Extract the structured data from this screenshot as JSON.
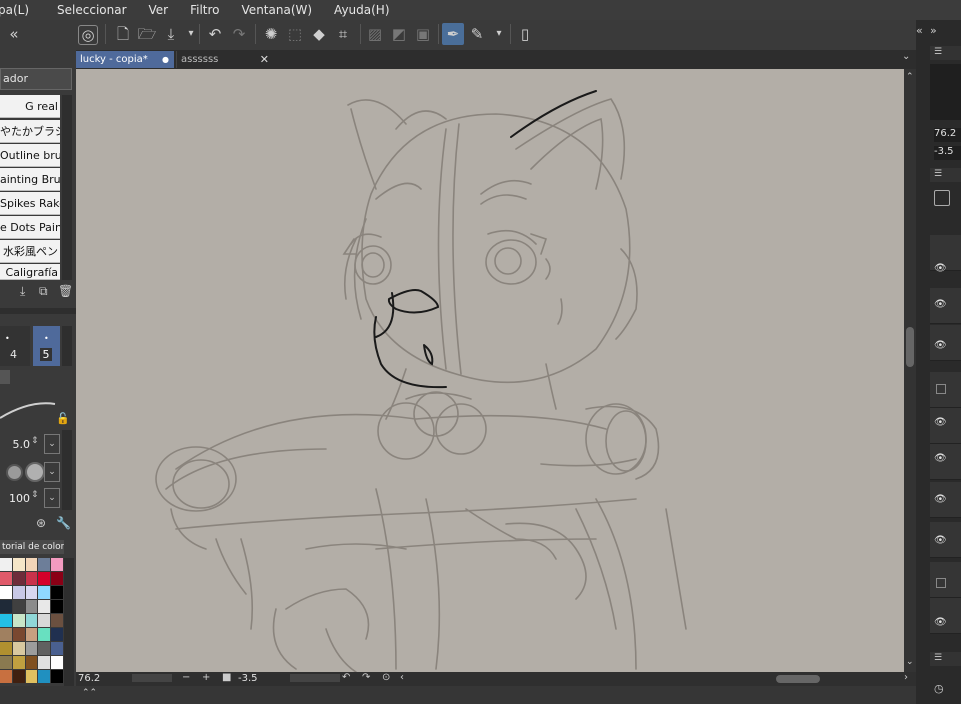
{
  "menu": {
    "items": [
      "pa(L)",
      "Seleccionar",
      "Ver",
      "Filtro",
      "Ventana(W)",
      "Ayuda(H)"
    ]
  },
  "tabs": [
    {
      "label": "lucky - copia*",
      "active": true
    },
    {
      "label": "assssss",
      "active": false
    }
  ],
  "left_panel": {
    "subtool_header": "ador",
    "brushes": [
      "G real",
      "やたかブラシ",
      "Outline brush",
      "ainting Brush",
      "Spikes Rake",
      "e Dots Paint",
      "水彩風ペン",
      "Caligrafía"
    ],
    "size_options": [
      "4",
      "5"
    ],
    "brush_size": "5.0",
    "opacity": "100",
    "color_set_title": "torial de color",
    "swatches": [
      "#f0f0f0",
      "#f5e6c8",
      "#f2d5b8",
      "#6d7e99",
      "#f39bc0",
      "#e05a6a",
      "#6e2c3a",
      "#c9324b",
      "#d4002a",
      "#8a0016",
      "#ffffff",
      "#c8c8e6",
      "#d8d8f0",
      "#8fd8ff",
      "#000000",
      "#1f2a38",
      "#404040",
      "#8c8c8c",
      "#e8e8e8",
      "#000000",
      "#23c0e6",
      "#c8e6c8",
      "#8fd8d8",
      "#d8d8d8",
      "#6b5040",
      "#a08060",
      "#7a4830",
      "#c8a080",
      "#68e0c0",
      "#203050",
      "#b09030",
      "#d8c8a0",
      "#9c9c9c",
      "#606060",
      "#4a6090",
      "#8a7a50",
      "#c0a040",
      "#805020",
      "#e0e0e0",
      "#ffffff",
      "#c87040",
      "#402010",
      "#e0c060",
      "#2090c0",
      "#000000"
    ]
  },
  "status": {
    "zoom": "76.2",
    "rotation": "-3.5"
  },
  "right_panel": {
    "zoom": "76.2",
    "rotation": "-3.5"
  },
  "colors": {
    "canvas_bg": "#b3aea7",
    "sketch_stroke": "#8a847d",
    "ink_stroke": "#1a1a1a"
  }
}
